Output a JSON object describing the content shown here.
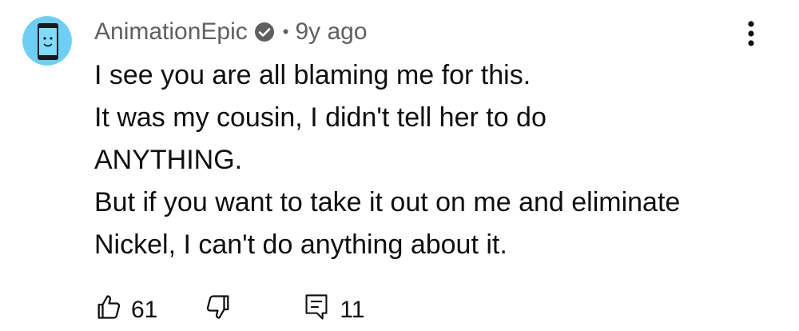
{
  "comment": {
    "author": "AnimationEpic",
    "separator": "•",
    "timestamp": "9y ago",
    "verified": true,
    "avatar_icon": "phone-face-avatar",
    "text_lines": [
      "I see you are all blaming me for this.",
      "It was my cousin, I didn't tell her to do",
      "ANYTHING.",
      "But if you want to take it out on me and eliminate",
      "Nickel, I can't do anything about it."
    ]
  },
  "actions": {
    "like_count": "61",
    "reply_count": "11"
  },
  "icons": {
    "like": "thumb-up-icon",
    "dislike": "thumb-down-icon",
    "reply": "comment-icon",
    "more": "more-vertical-icon",
    "verified": "verified-check-icon"
  },
  "colors": {
    "text": "#0f0f0f",
    "secondary": "#606060",
    "avatar_bg": "#6ecff6"
  }
}
